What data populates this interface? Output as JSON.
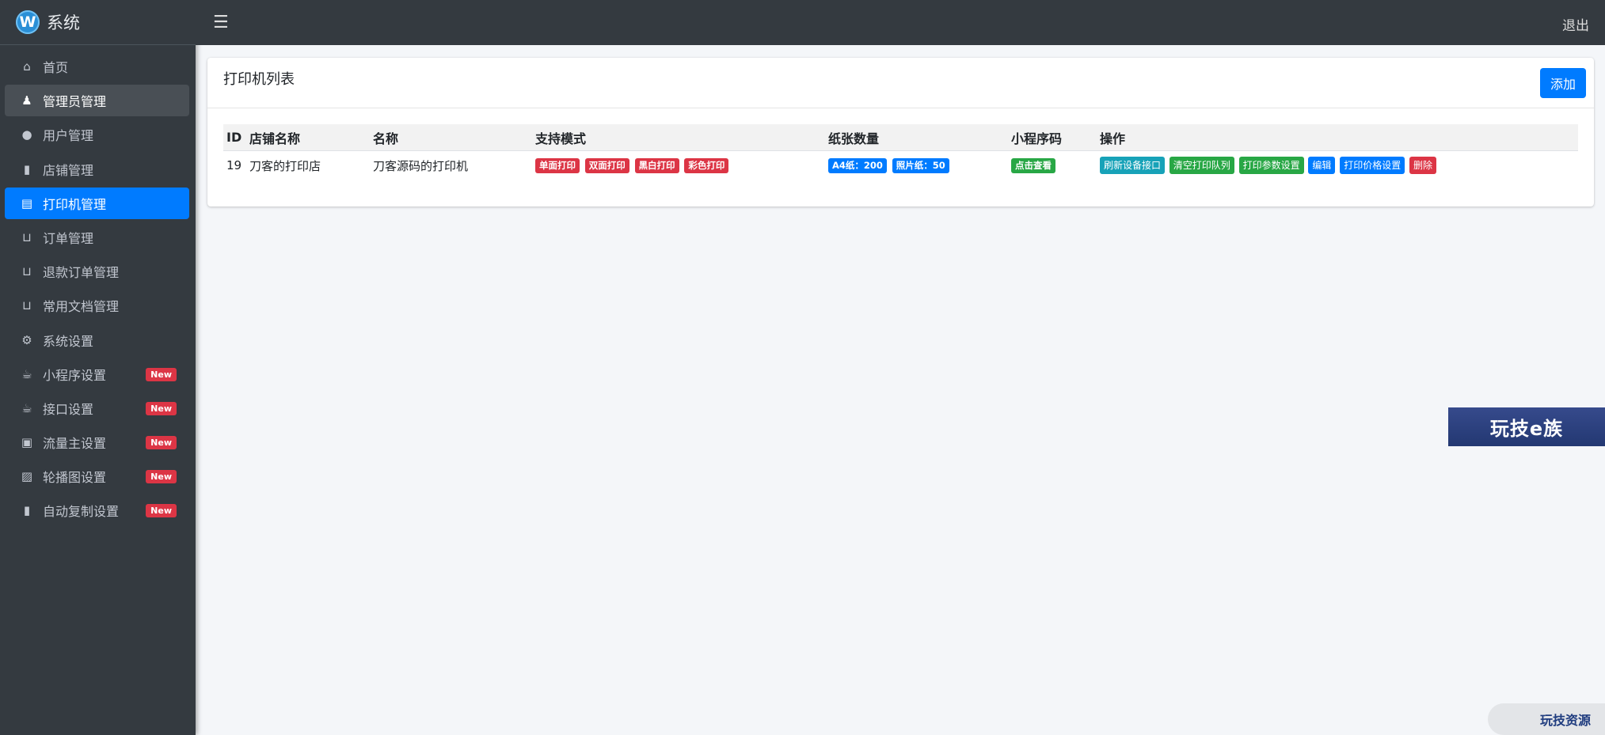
{
  "brand": {
    "name": "系统"
  },
  "topbar": {
    "logout": "退出"
  },
  "sidebar": {
    "items": [
      {
        "label": "首页",
        "icon": "home-icon"
      },
      {
        "label": "管理员管理",
        "icon": "user-secret-icon"
      },
      {
        "label": "用户管理",
        "icon": "user-icon"
      },
      {
        "label": "店铺管理",
        "icon": "shopping-bag-icon"
      },
      {
        "label": "打印机管理",
        "icon": "printer-icon"
      },
      {
        "label": "订单管理",
        "icon": "basket-icon"
      },
      {
        "label": "退款订单管理",
        "icon": "basket-icon"
      },
      {
        "label": "常用文档管理",
        "icon": "basket-icon"
      },
      {
        "label": "系统设置",
        "icon": "gears-icon"
      },
      {
        "label": "小程序设置",
        "icon": "cup-icon",
        "badge": "New"
      },
      {
        "label": "接口设置",
        "icon": "cup-icon",
        "badge": "New"
      },
      {
        "label": "流量主设置",
        "icon": "ad-icon",
        "badge": "New"
      },
      {
        "label": "轮播图设置",
        "icon": "image-icon",
        "badge": "New"
      },
      {
        "label": "自动复制设置",
        "icon": "clipboard-icon",
        "badge": "New"
      }
    ]
  },
  "card": {
    "title": "打印机列表",
    "add_label": "添加"
  },
  "table": {
    "headers": [
      "ID",
      "店铺名称",
      "名称",
      "支持模式",
      "纸张数量",
      "小程序码",
      "操作"
    ],
    "rows": [
      {
        "id": "19",
        "shop": "刀客的打印店",
        "name": "刀客源码的打印机",
        "modes": [
          "单面打印",
          "双面打印",
          "黑白打印",
          "彩色打印"
        ],
        "paper": [
          "A4纸：200",
          "照片纸：50"
        ],
        "qrcode": "点击查看",
        "actions": [
          "刷新设备接口",
          "清空打印队列",
          "打印参数设置",
          "编辑",
          "打印价格设置",
          "删除"
        ]
      }
    ]
  },
  "watermarks": {
    "banner": "玩技e族",
    "bottom": "玩技资源"
  }
}
